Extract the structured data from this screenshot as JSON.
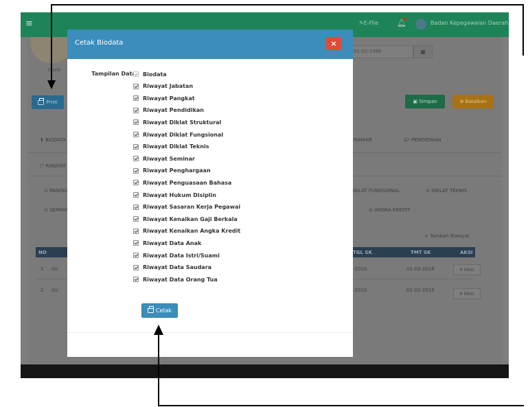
{
  "app": {
    "topbar": {
      "menu_icon": "menu-icon",
      "efile_label": "✎E-File",
      "username": "Badan Kepegawaian Daerah"
    },
    "background": {
      "photo_caption": "Ganti",
      "date_value": "01-02-1990",
      "print_label": "Print",
      "save_label": "Simpan",
      "cancel_label": "Batalkan",
      "tab_row1": [
        "BIODATA",
        "TERAKHIR",
        "PENDIDIKAN"
      ],
      "tab_row2": [
        "RIWAYAT"
      ],
      "subtab_row1": [
        "PANGKAT",
        "DIKLAT FUNGSIONAL",
        "DIKLAT TEKNIS"
      ],
      "subtab_row2": [
        "SEMINAR",
        "ANGKA KREDIT"
      ],
      "add_history": "+ Tambah Riwayat",
      "table": {
        "headers": [
          "NO",
          "TGL SK",
          "TMT SK",
          "AKSI"
        ],
        "rows": [
          {
            "no": "1",
            "golongan": "II/c",
            "tgl_sk": "-2016",
            "tmt_sk": "01-03-2016",
            "aksi": "▾ Aksi"
          },
          {
            "no": "2",
            "golongan": "II/c",
            "tgl_sk": "-2015",
            "tmt_sk": "01-02-2015",
            "aksi": "▾ Aksi"
          }
        ]
      }
    }
  },
  "modal": {
    "title": "Cetak Biodata",
    "close_label": "×",
    "form_label": "Tampilan Data:",
    "options": [
      {
        "label": "Biodata",
        "checked": true,
        "disabled": true
      },
      {
        "label": "Riwayat Jabatan",
        "checked": true
      },
      {
        "label": "Riwayat Pangkat",
        "checked": true
      },
      {
        "label": "Riwayat Pendidikan",
        "checked": true
      },
      {
        "label": "Riwayat Diklat Struktural",
        "checked": true
      },
      {
        "label": "Riwayat Diklat Fungsional",
        "checked": true
      },
      {
        "label": "Riwayat Diklat Teknis",
        "checked": true
      },
      {
        "label": "Riwayat Seminar",
        "checked": true
      },
      {
        "label": "Riwayat Penghargaan",
        "checked": true
      },
      {
        "label": "Riwayat Penguasaan Bahasa",
        "checked": true
      },
      {
        "label": "Riwayat Hukum Disiplin",
        "checked": true
      },
      {
        "label": "Riwayat Sasaran Kerja Pegawai",
        "checked": true
      },
      {
        "label": "Riwayat Kenaikan Gaji Berkala",
        "checked": true
      },
      {
        "label": "Riwayat Kenaikan Angka Kredit",
        "checked": true
      },
      {
        "label": "Riwayat Data Anak",
        "checked": true
      },
      {
        "label": "Riwayat Data Istri/Suami",
        "checked": true
      },
      {
        "label": "Riwayat Data Saudara",
        "checked": true
      },
      {
        "label": "Riwayat Data Orang Tua",
        "checked": true
      }
    ],
    "print_button": "Cetak"
  },
  "colors": {
    "modal_header": "#3c8dbc",
    "close_button": "#dd4b39",
    "topbar": "#1e8458",
    "save_button": "#1e7a4c",
    "cancel_button": "#c98a13"
  }
}
